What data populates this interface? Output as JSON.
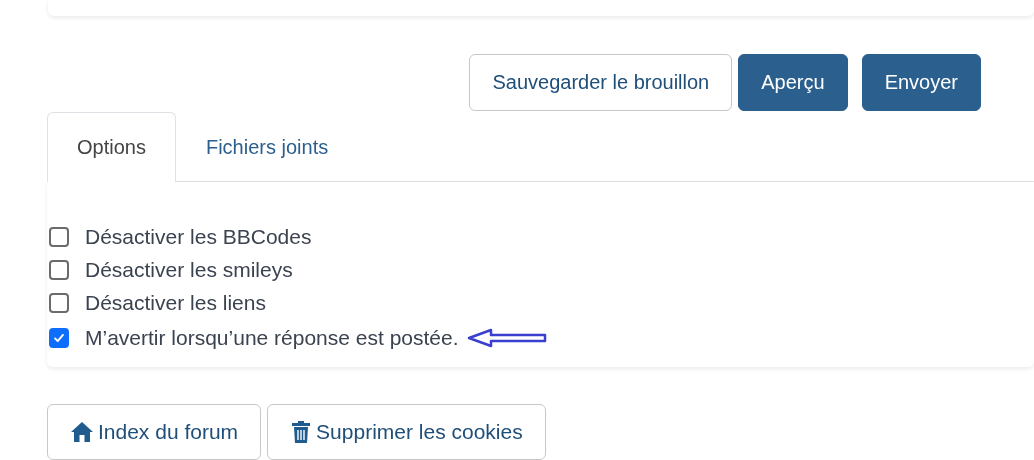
{
  "actions": [
    {
      "label": "Sauvegarder le brouillon",
      "kind": "secondary"
    },
    {
      "label": "Aperçu",
      "kind": "primary"
    },
    {
      "label": "Envoyer",
      "kind": "primary"
    }
  ],
  "tabs": [
    {
      "label": "Options",
      "selected": true
    },
    {
      "label": "Fichiers joints",
      "selected": false
    }
  ],
  "options": [
    {
      "label": "Désactiver les BBCodes",
      "checked": false
    },
    {
      "label": "Désactiver les smileys",
      "checked": false
    },
    {
      "label": "Désactiver les liens",
      "checked": false
    },
    {
      "label": "M’avertir lorsqu’une réponse est postée.",
      "checked": true
    }
  ],
  "footer_buttons": [
    {
      "label": "Index du forum"
    },
    {
      "label": "Supprimer les cookies"
    }
  ]
}
